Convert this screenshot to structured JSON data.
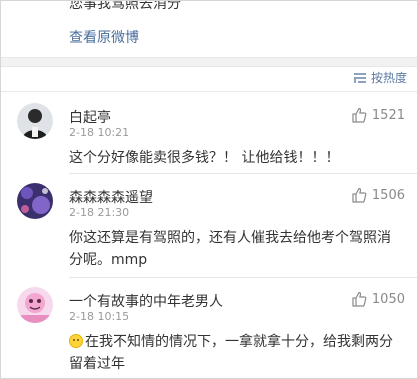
{
  "post": {
    "tail_text": "您事我驾照去消分",
    "view_original": "查看原微博"
  },
  "sort": {
    "label": "按热度",
    "icon": "sort-lines-icon"
  },
  "comments": [
    {
      "username": "白起亭",
      "time": "2-18 10:21",
      "likes": "1521",
      "text": "这个分好像能卖很多钱？！ 让他给钱！！！"
    },
    {
      "username": "森森森森遥望",
      "time": "2-18 21:30",
      "likes": "1506",
      "text": "你这还算是有驾照的，还有人催我去给他考个驾照消分呢。mmp"
    },
    {
      "username": "一个有故事的中年老男人",
      "time": "2-18 10:15",
      "likes": "1050",
      "text": "在我不知情的情况下，一拿就拿十分，给我剩两分留着过年"
    }
  ],
  "colors": {
    "link": "#4a6e9d",
    "sort": "#5a7aa2",
    "meta": "#9a9a9a"
  }
}
